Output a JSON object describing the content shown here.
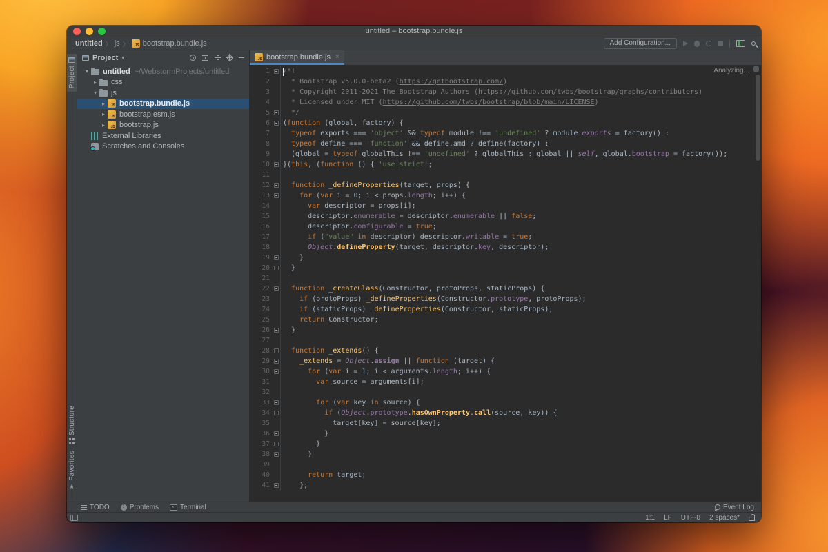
{
  "window": {
    "title": "untitled – bootstrap.bundle.js"
  },
  "breadcrumbs": {
    "segments": [
      "untitled",
      "js",
      "bootstrap.bundle.js"
    ]
  },
  "toolbar": {
    "add_configuration_label": "Add Configuration..."
  },
  "tool_stripes": {
    "project": "Project",
    "structure": "Structure",
    "favorites": "Favorites"
  },
  "project_panel": {
    "header": {
      "title": "Project"
    },
    "tree": [
      {
        "depth": 0,
        "chevron": "down",
        "icon": "folder-icon",
        "label": "untitled",
        "sublabel": "~/WebstormProjects/untitled",
        "bold": true,
        "selected": false
      },
      {
        "depth": 1,
        "chevron": "right",
        "icon": "folder-icon",
        "label": "css",
        "sublabel": "",
        "bold": false,
        "selected": false
      },
      {
        "depth": 1,
        "chevron": "down",
        "icon": "folder-icon",
        "label": "js",
        "sublabel": "",
        "bold": false,
        "selected": false
      },
      {
        "depth": 2,
        "chevron": "right",
        "icon": "js-file-icon",
        "label": "bootstrap.bundle.js",
        "sublabel": "",
        "bold": false,
        "selected": true
      },
      {
        "depth": 2,
        "chevron": "right",
        "icon": "js-file-icon",
        "label": "bootstrap.esm.js",
        "sublabel": "",
        "bold": false,
        "selected": false
      },
      {
        "depth": 2,
        "chevron": "right",
        "icon": "js-file-icon",
        "label": "bootstrap.js",
        "sublabel": "",
        "bold": false,
        "selected": false
      },
      {
        "depth": 1,
        "chevron": null,
        "icon": "external-libraries-icon",
        "label": "External Libraries",
        "sublabel": "",
        "bold": false,
        "selected": false
      },
      {
        "depth": 1,
        "chevron": null,
        "icon": "scratches-icon",
        "label": "Scratches and Consoles",
        "sublabel": "",
        "bold": false,
        "selected": false
      }
    ]
  },
  "editor": {
    "tabs": [
      {
        "label": "bootstrap.bundle.js",
        "icon": "js-file-icon",
        "close": "×"
      }
    ],
    "analyzing_label": "Analyzing...",
    "fold_lines": [
      1,
      5,
      6,
      10,
      12,
      13,
      19,
      20,
      22,
      26,
      28,
      29,
      30,
      33,
      34,
      36,
      37,
      38,
      41
    ],
    "caret_line": 1,
    "lines": [
      {
        "n": 1,
        "tokens": [
          [
            "c",
            "/*!"
          ]
        ]
      },
      {
        "n": 2,
        "tokens": [
          [
            "c",
            "  * Bootstrap v5.0.0-beta2 ("
          ],
          [
            "cl",
            "https://getbootstrap.com/"
          ],
          [
            "c",
            ")"
          ]
        ]
      },
      {
        "n": 3,
        "tokens": [
          [
            "c",
            "  * Copyright 2011-2021 The Bootstrap Authors ("
          ],
          [
            "cl",
            "https://github.com/twbs/bootstrap/graphs/contributors"
          ],
          [
            "c",
            ")"
          ]
        ]
      },
      {
        "n": 4,
        "tokens": [
          [
            "c",
            "  * Licensed under MIT ("
          ],
          [
            "cl",
            "https://github.com/twbs/bootstrap/blob/main/LICENSE"
          ],
          [
            "c",
            ")"
          ]
        ]
      },
      {
        "n": 5,
        "tokens": [
          [
            "c",
            "  */"
          ]
        ]
      },
      {
        "n": 6,
        "tokens": [
          [
            "t",
            "("
          ],
          [
            "k",
            "function"
          ],
          [
            "t",
            " (global, factory) {"
          ]
        ]
      },
      {
        "n": 7,
        "tokens": [
          [
            "t",
            "  "
          ],
          [
            "k",
            "typeof"
          ],
          [
            "t",
            " exports === "
          ],
          [
            "s",
            "'object'"
          ],
          [
            "t",
            " && "
          ],
          [
            "k",
            "typeof"
          ],
          [
            "t",
            " module !== "
          ],
          [
            "s",
            "'undefined'"
          ],
          [
            "t",
            " ? module."
          ],
          [
            "pi",
            "exports"
          ],
          [
            "t",
            " = factory() :"
          ]
        ]
      },
      {
        "n": 8,
        "tokens": [
          [
            "t",
            "  "
          ],
          [
            "k",
            "typeof"
          ],
          [
            "t",
            " define === "
          ],
          [
            "s",
            "'function'"
          ],
          [
            "t",
            " && define.amd ? define(factory) :"
          ]
        ]
      },
      {
        "n": 9,
        "tokens": [
          [
            "t",
            "  (global = "
          ],
          [
            "k",
            "typeof"
          ],
          [
            "t",
            " globalThis !== "
          ],
          [
            "s",
            "'undefined'"
          ],
          [
            "t",
            " ? globalThis : global || "
          ],
          [
            "pi",
            "self"
          ],
          [
            "t",
            ", global."
          ],
          [
            "p",
            "bootstrap"
          ],
          [
            "t",
            " = factory());"
          ]
        ]
      },
      {
        "n": 10,
        "tokens": [
          [
            "t",
            "}("
          ],
          [
            "k",
            "this"
          ],
          [
            "t",
            ", ("
          ],
          [
            "k",
            "function"
          ],
          [
            "t",
            " () { "
          ],
          [
            "s",
            "'use strict'"
          ],
          [
            "t",
            ";"
          ]
        ]
      },
      {
        "n": 11,
        "tokens": []
      },
      {
        "n": 12,
        "tokens": [
          [
            "t",
            "  "
          ],
          [
            "k",
            "function"
          ],
          [
            "t",
            " "
          ],
          [
            "f",
            "_defineProperties"
          ],
          [
            "t",
            "(target, props) {"
          ]
        ]
      },
      {
        "n": 13,
        "tokens": [
          [
            "t",
            "    "
          ],
          [
            "k",
            "for"
          ],
          [
            "t",
            " ("
          ],
          [
            "k",
            "var"
          ],
          [
            "t",
            " i = "
          ],
          [
            "num",
            "0"
          ],
          [
            "t",
            "; i < props."
          ],
          [
            "p",
            "length"
          ],
          [
            "t",
            "; i++) {"
          ]
        ]
      },
      {
        "n": 14,
        "tokens": [
          [
            "t",
            "      "
          ],
          [
            "k",
            "var"
          ],
          [
            "t",
            " descriptor = props[i];"
          ]
        ]
      },
      {
        "n": 15,
        "tokens": [
          [
            "t",
            "      descriptor."
          ],
          [
            "p",
            "enumerable"
          ],
          [
            "t",
            " = descriptor."
          ],
          [
            "p",
            "enumerable"
          ],
          [
            "t",
            " || "
          ],
          [
            "k",
            "false"
          ],
          [
            "t",
            ";"
          ]
        ]
      },
      {
        "n": 16,
        "tokens": [
          [
            "t",
            "      descriptor."
          ],
          [
            "p",
            "configurable"
          ],
          [
            "t",
            " = "
          ],
          [
            "k",
            "true"
          ],
          [
            "t",
            ";"
          ]
        ]
      },
      {
        "n": 17,
        "tokens": [
          [
            "t",
            "      "
          ],
          [
            "k",
            "if"
          ],
          [
            "t",
            " ("
          ],
          [
            "s",
            "\"value\""
          ],
          [
            "t",
            " "
          ],
          [
            "k",
            "in"
          ],
          [
            "t",
            " descriptor) descriptor."
          ],
          [
            "p",
            "writable"
          ],
          [
            "t",
            " = "
          ],
          [
            "k",
            "true"
          ],
          [
            "t",
            ";"
          ]
        ]
      },
      {
        "n": 18,
        "tokens": [
          [
            "t",
            "      "
          ],
          [
            "oi",
            "Object"
          ],
          [
            "t",
            "."
          ],
          [
            "fb",
            "defineProperty"
          ],
          [
            "t",
            "(target, descriptor."
          ],
          [
            "p",
            "key"
          ],
          [
            "t",
            ", descriptor);"
          ]
        ]
      },
      {
        "n": 19,
        "tokens": [
          [
            "t",
            "    }"
          ]
        ]
      },
      {
        "n": 20,
        "tokens": [
          [
            "t",
            "  }"
          ]
        ]
      },
      {
        "n": 21,
        "tokens": []
      },
      {
        "n": 22,
        "tokens": [
          [
            "t",
            "  "
          ],
          [
            "k",
            "function"
          ],
          [
            "t",
            " "
          ],
          [
            "f",
            "_createClass"
          ],
          [
            "t",
            "(Constructor, protoProps, staticProps) {"
          ]
        ]
      },
      {
        "n": 23,
        "tokens": [
          [
            "t",
            "    "
          ],
          [
            "k",
            "if"
          ],
          [
            "t",
            " (protoProps) "
          ],
          [
            "f",
            "_defineProperties"
          ],
          [
            "t",
            "(Constructor."
          ],
          [
            "p",
            "prototype"
          ],
          [
            "t",
            ", protoProps);"
          ]
        ]
      },
      {
        "n": 24,
        "tokens": [
          [
            "t",
            "    "
          ],
          [
            "k",
            "if"
          ],
          [
            "t",
            " (staticProps) "
          ],
          [
            "f",
            "_defineProperties"
          ],
          [
            "t",
            "(Constructor, staticProps);"
          ]
        ]
      },
      {
        "n": 25,
        "tokens": [
          [
            "t",
            "    "
          ],
          [
            "k",
            "return"
          ],
          [
            "t",
            " Constructor;"
          ]
        ]
      },
      {
        "n": 26,
        "tokens": [
          [
            "t",
            "  }"
          ]
        ]
      },
      {
        "n": 27,
        "tokens": []
      },
      {
        "n": 28,
        "tokens": [
          [
            "t",
            "  "
          ],
          [
            "k",
            "function"
          ],
          [
            "t",
            " "
          ],
          [
            "f",
            "_extends"
          ],
          [
            "t",
            "() {"
          ]
        ]
      },
      {
        "n": 29,
        "tokens": [
          [
            "t",
            "    "
          ],
          [
            "f",
            "_extends"
          ],
          [
            "t",
            " = "
          ],
          [
            "oi",
            "Object"
          ],
          [
            "t",
            "."
          ],
          [
            "pb",
            "assign"
          ],
          [
            "t",
            " || "
          ],
          [
            "k",
            "function"
          ],
          [
            "t",
            " (target) {"
          ]
        ]
      },
      {
        "n": 30,
        "tokens": [
          [
            "t",
            "      "
          ],
          [
            "k",
            "for"
          ],
          [
            "t",
            " ("
          ],
          [
            "k",
            "var"
          ],
          [
            "t",
            " i = "
          ],
          [
            "num",
            "1"
          ],
          [
            "t",
            "; i < arguments."
          ],
          [
            "p",
            "length"
          ],
          [
            "t",
            "; i++) {"
          ]
        ]
      },
      {
        "n": 31,
        "tokens": [
          [
            "t",
            "        "
          ],
          [
            "k",
            "var"
          ],
          [
            "t",
            " source = arguments[i];"
          ]
        ]
      },
      {
        "n": 32,
        "tokens": []
      },
      {
        "n": 33,
        "tokens": [
          [
            "t",
            "        "
          ],
          [
            "k",
            "for"
          ],
          [
            "t",
            " ("
          ],
          [
            "k",
            "var"
          ],
          [
            "t",
            " key "
          ],
          [
            "k",
            "in"
          ],
          [
            "t",
            " source) {"
          ]
        ]
      },
      {
        "n": 34,
        "tokens": [
          [
            "t",
            "          "
          ],
          [
            "k",
            "if"
          ],
          [
            "t",
            " ("
          ],
          [
            "oi",
            "Object"
          ],
          [
            "t",
            "."
          ],
          [
            "p",
            "prototype"
          ],
          [
            "t",
            "."
          ],
          [
            "fb",
            "hasOwnProperty"
          ],
          [
            "t",
            "."
          ],
          [
            "fb",
            "call"
          ],
          [
            "t",
            "(source, key)) {"
          ]
        ]
      },
      {
        "n": 35,
        "tokens": [
          [
            "t",
            "            target[key] = source[key];"
          ]
        ]
      },
      {
        "n": 36,
        "tokens": [
          [
            "t",
            "          }"
          ]
        ]
      },
      {
        "n": 37,
        "tokens": [
          [
            "t",
            "        }"
          ]
        ]
      },
      {
        "n": 38,
        "tokens": [
          [
            "t",
            "      }"
          ]
        ]
      },
      {
        "n": 39,
        "tokens": []
      },
      {
        "n": 40,
        "tokens": [
          [
            "t",
            "      "
          ],
          [
            "k",
            "return"
          ],
          [
            "t",
            " target;"
          ]
        ]
      },
      {
        "n": 41,
        "tokens": [
          [
            "t",
            "    };"
          ]
        ]
      }
    ]
  },
  "bottom_toolbar": {
    "items": [
      {
        "label": "TODO",
        "icon": "todo-list-icon"
      },
      {
        "label": "Problems",
        "icon": "problems-icon"
      },
      {
        "label": "Terminal",
        "icon": "terminal-icon"
      }
    ],
    "event_log_label": "Event Log"
  },
  "status_bar": {
    "caret_position": "1:1",
    "line_ending": "LF",
    "encoding": "UTF-8",
    "indent": "2 spaces*"
  },
  "colors": {
    "editor_bg": "#2B2B2B",
    "panel_bg": "#3C3F41",
    "selection_blue": "#2B4F72",
    "tab_underline": "#4A88C8",
    "keyword": "#CC7832",
    "string": "#6A8759",
    "number": "#6897BB",
    "comment": "#808080",
    "function_name": "#FFC66D",
    "property": "#9876AA",
    "plain_text": "#A9B7C6"
  }
}
